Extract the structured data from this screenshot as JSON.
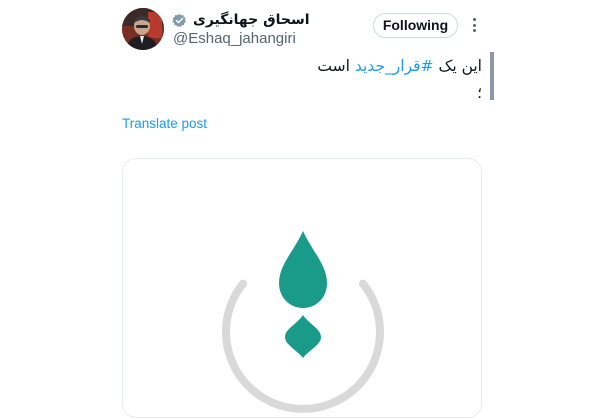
{
  "author": {
    "display_name": "اسحاق جهانگیری",
    "handle": "@Eshaq_jahangiri",
    "verified_icon": "verified-badge-icon"
  },
  "actions": {
    "follow_label": "Following",
    "more_icon": "more-options-icon"
  },
  "post": {
    "text_prefix": "این یک ",
    "hashtag": "#قرار_جدید",
    "text_suffix": " است",
    "text_line2": "؛",
    "translate_label": "Translate post"
  },
  "media": {
    "logo_icon": "teal-flame-drop-logo",
    "colors": {
      "logo": "#1a9b8a",
      "ring": "#d9d9d9"
    }
  },
  "colors": {
    "accent": "#1d9bf0",
    "secondary_text": "#536471",
    "primary_text": "#0f1419"
  }
}
